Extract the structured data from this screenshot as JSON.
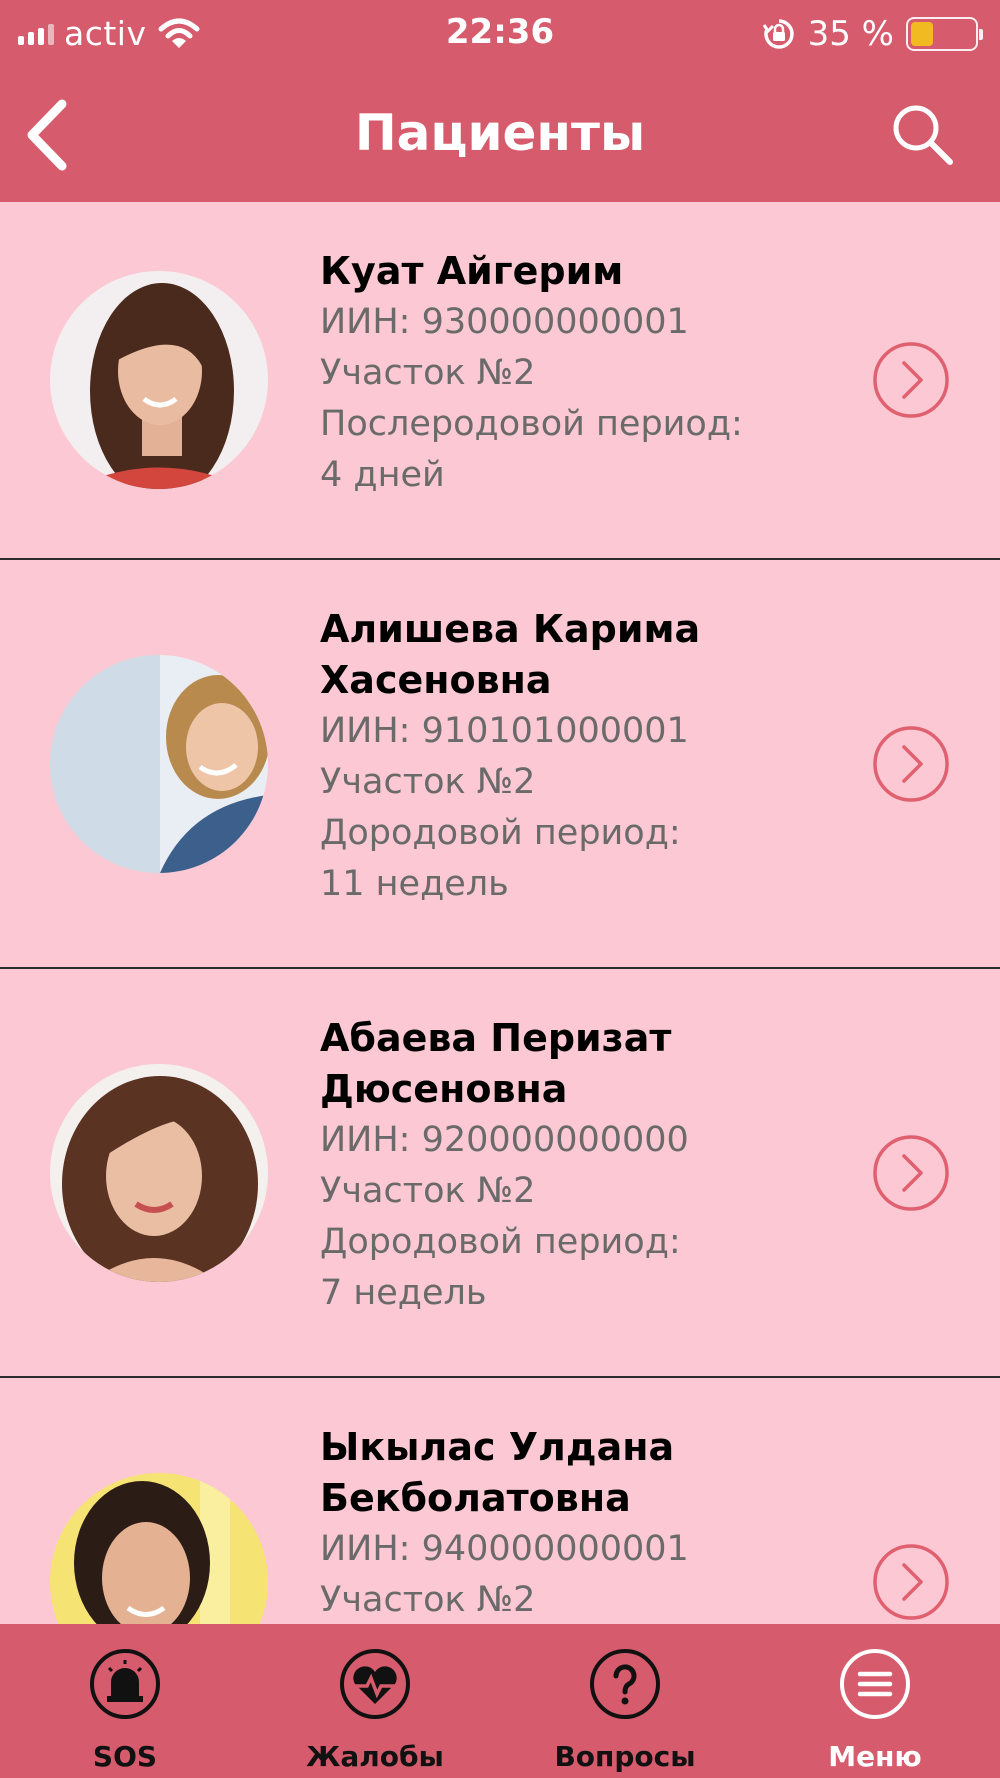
{
  "status_bar": {
    "carrier": "activ",
    "time": "22:36",
    "battery_percent": "35 %",
    "battery_level": 0.35,
    "wifi_icon": "wifi-icon",
    "rotation_lock_icon": "rotation-lock-icon"
  },
  "header": {
    "title": "Пациенты",
    "back_icon": "chevron-left-icon",
    "search_icon": "search-icon"
  },
  "colors": {
    "header_bg": "#d65b6c",
    "list_bg": "#fbc8d3",
    "accent": "#e0606f",
    "battery_fill": "#f5c518"
  },
  "patients": [
    {
      "name_lines": [
        "Куат Айгерим"
      ],
      "iin": "ИИН: 930000000001",
      "district": "Участок №2",
      "period_label": "Послеродовой период:",
      "period_value": "4 дней"
    },
    {
      "name_lines": [
        "Алишева Карима",
        "Хасеновна"
      ],
      "iin": "ИИН: 910101000001",
      "district": "Участок №2",
      "period_label": "Дородовой период:",
      "period_value": "11 недель"
    },
    {
      "name_lines": [
        "Абаева Перизат",
        "Дюсеновна"
      ],
      "iin": "ИИН: 920000000000",
      "district": "Участок №2",
      "period_label": "Дородовой период:",
      "period_value": "7 недель"
    },
    {
      "name_lines": [
        "Ыкылас Улдана",
        "Бекболатовна"
      ],
      "iin": "ИИН: 940000000001",
      "district": "Участок №2",
      "period_label": "",
      "period_value": ""
    }
  ],
  "tabbar": {
    "tabs": [
      {
        "label": "SOS",
        "icon": "siren-icon"
      },
      {
        "label": "Жалобы",
        "icon": "heart-pulse-icon"
      },
      {
        "label": "Вопросы",
        "icon": "question-icon"
      },
      {
        "label": "Меню",
        "icon": "menu-icon"
      }
    ],
    "active_index": 3
  }
}
